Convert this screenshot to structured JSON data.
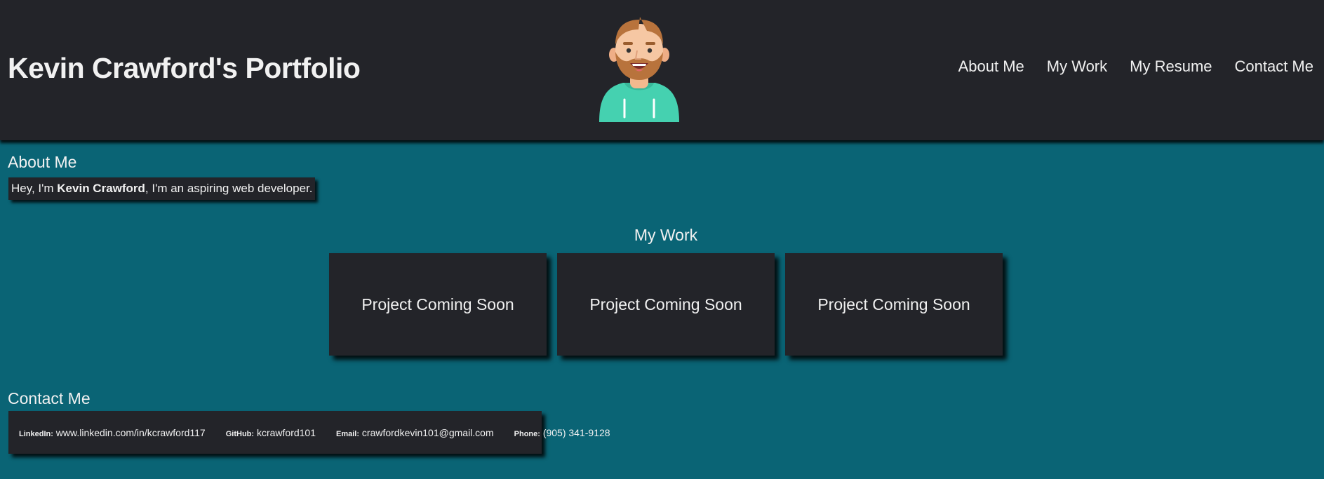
{
  "header": {
    "title": "Kevin Crawford's Portfolio",
    "avatar_icon": "avatar-icon",
    "nav": [
      "About Me",
      "My Work",
      "My Resume",
      "Contact Me"
    ]
  },
  "about": {
    "heading": "About Me",
    "intro_prefix": "Hey, I'm ",
    "name": "Kevin Crawford",
    "intro_suffix": ", I'm an aspiring web developer."
  },
  "work": {
    "heading": "My Work",
    "projects": [
      "Project Coming Soon",
      "Project Coming Soon",
      "Project Coming Soon"
    ]
  },
  "contact": {
    "heading": "Contact Me",
    "items": [
      {
        "label": "LinkedIn:",
        "value": "www.linkedin.com/in/kcrawford117"
      },
      {
        "label": "GitHub:",
        "value": "kcrawford101"
      },
      {
        "label": "Email:",
        "value": "crawfordkevin101@gmail.com"
      },
      {
        "label": "Phone:",
        "value": "(905) 341-9128"
      }
    ]
  },
  "colors": {
    "background": "#0a6475",
    "panel": "#232429",
    "text": "#f1f1f1",
    "hoodie": "#45d1b0"
  }
}
